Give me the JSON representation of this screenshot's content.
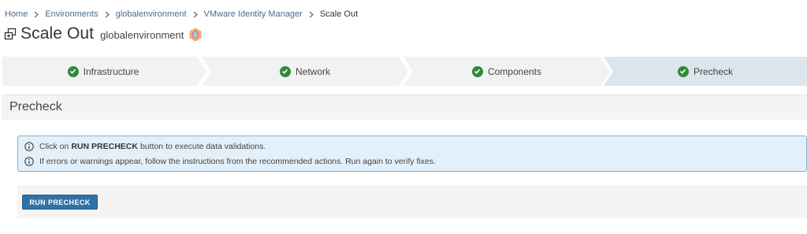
{
  "breadcrumb": {
    "items": [
      {
        "label": "Home"
      },
      {
        "label": "Environments"
      },
      {
        "label": "globalenvironment"
      },
      {
        "label": "VMware Identity Manager"
      }
    ],
    "current": "Scale Out"
  },
  "header": {
    "title": "Scale Out",
    "environment": "globalenvironment",
    "title_icon": "scale-out-icon",
    "env_icon": "environment-logo-icon"
  },
  "wizard": {
    "steps": [
      {
        "label": "Infrastructure",
        "status": "complete"
      },
      {
        "label": "Network",
        "status": "complete"
      },
      {
        "label": "Components",
        "status": "complete"
      },
      {
        "label": "Precheck",
        "status": "complete",
        "active": true
      }
    ],
    "colors": {
      "inactive": "#f2f2f2",
      "active": "#dde5ec",
      "check": "#2f8a3c"
    }
  },
  "precheck": {
    "title": "Precheck",
    "alert": {
      "line1_prefix": "Click on",
      "line1_bold": "RUN PRECHECK",
      "line1_suffix": "button to execute data validations.",
      "line2": "If errors or warnings appear, follow the instructions from the recommended actions. Run again to verify fixes."
    },
    "run_button_label": "RUN PRECHECK"
  },
  "colors": {
    "link": "#4a6b8c",
    "primary": "#2f72a8",
    "alert_bg": "#e3f0fa",
    "alert_border": "#7fb0d6"
  }
}
